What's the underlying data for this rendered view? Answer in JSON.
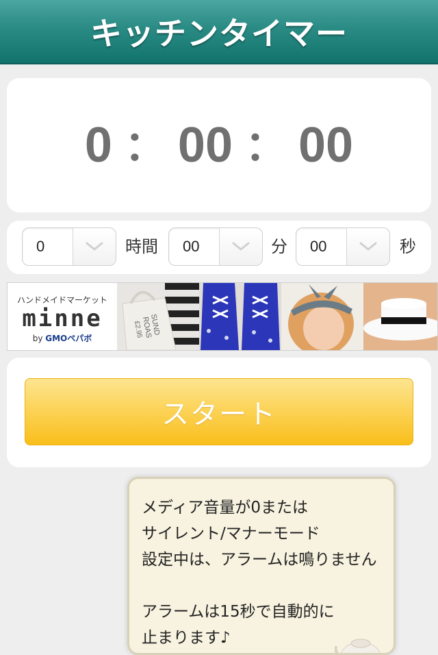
{
  "header": {
    "title": "キッチンタイマー"
  },
  "timer": {
    "hours": "0",
    "minutes": "00",
    "seconds": "00",
    "separator": "："
  },
  "settings": {
    "hours_value": "0",
    "hours_unit": "時間",
    "minutes_value": "00",
    "minutes_unit": "分",
    "seconds_value": "00",
    "seconds_unit": "秒"
  },
  "ad": {
    "subtitle": "ハンドメイドマーケット",
    "brand": "minne",
    "by_prefix": "by",
    "by_company": "GMOペパボ",
    "bag_text_1": "SUND",
    "bag_text_2": "ROAS",
    "bag_text_3": "£2.95"
  },
  "start": {
    "label": "スタート"
  },
  "notice": {
    "lines": [
      "メディア音量が0または",
      "サイレント/マナーモード",
      "設定中は、アラームは鳴りません",
      "",
      "アラームは15秒で自動的に",
      "止まります♪"
    ]
  },
  "colors": {
    "header": "#2a8a84",
    "start_button": "#fcd45a",
    "timer_text": "#707070",
    "notice_bg": "#f8f3e0"
  }
}
